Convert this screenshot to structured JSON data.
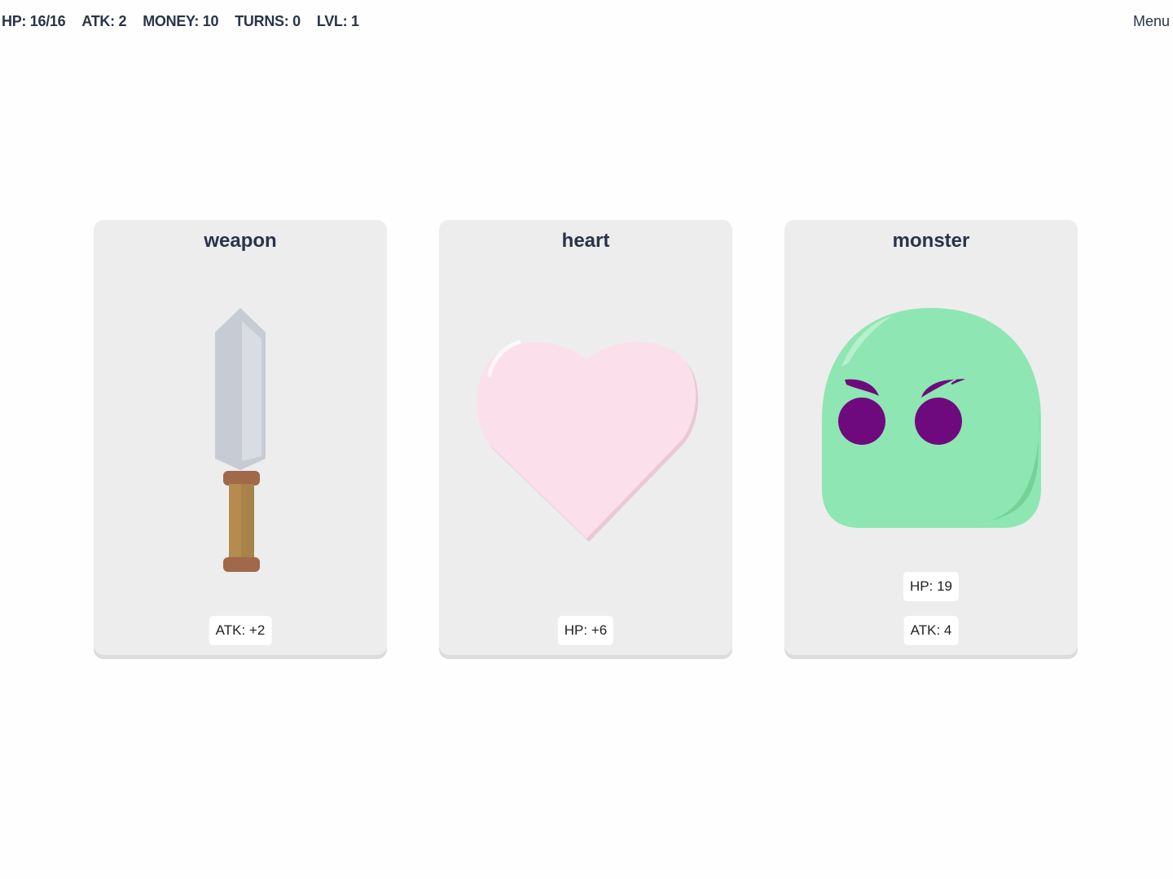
{
  "stats": {
    "hp": "HP: 16/16",
    "atk": "ATK: 2",
    "money": "MONEY: 10",
    "turns": "TURNS: 0",
    "lvl": "LVL: 1"
  },
  "menu_label": "Menu",
  "cards": [
    {
      "title": "weapon",
      "icon": "dagger-icon",
      "badges": [
        "ATK: +2"
      ]
    },
    {
      "title": "heart",
      "icon": "heart-icon",
      "badges": [
        "HP: +6"
      ]
    },
    {
      "title": "monster",
      "icon": "slime-monster-icon",
      "badges": [
        "HP: 19",
        "ATK: 4"
      ]
    }
  ],
  "colors": {
    "text": "#2a3448",
    "card_bg": "#ededed",
    "heart": "#fbdfea",
    "slime": "#8ee6b2",
    "slime_eye": "#6e0a7e"
  }
}
